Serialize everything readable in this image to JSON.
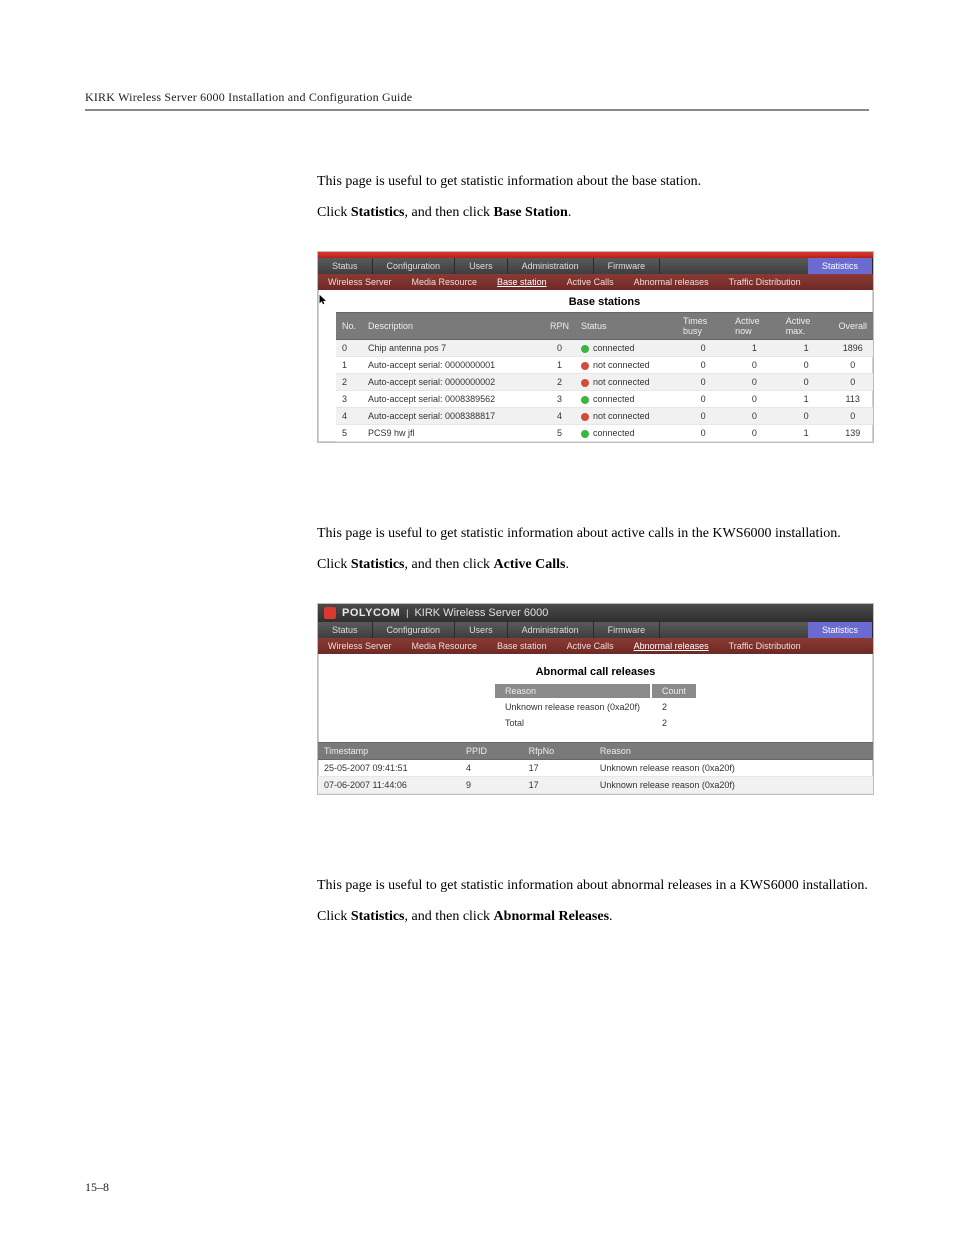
{
  "running_head": "KIRK Wireless Server 6000 Installation and Configuration Guide",
  "page_number": "15–8",
  "sections": {
    "base_intro": "This page is useful to get statistic information about the base station.",
    "base_click_pre": "Click ",
    "base_click_b1": "Statistics",
    "base_click_mid": ", and then click ",
    "base_click_b2": "Base Station",
    "base_click_post": ".",
    "active_intro": "This page is useful to get statistic information about active calls in the KWS6000 installation.",
    "active_click_b2": "Active Calls",
    "abn_intro": "This page is useful to get statistic information about abnormal releases in a KWS6000 installation.",
    "abn_click_b2": "Abnormal Releases"
  },
  "shot_nav": {
    "menus": [
      "Status",
      "Configuration",
      "Users",
      "Administration",
      "Firmware",
      "Statistics"
    ],
    "submenus": [
      "Wireless Server",
      "Media Resource",
      "Base station",
      "Active Calls",
      "Abnormal releases",
      "Traffic Distribution"
    ]
  },
  "shot_base": {
    "title": "Base stations",
    "headers": [
      "No.",
      "Description",
      "RPN",
      "Status",
      "Times busy",
      "Active now",
      "Active max.",
      "Overall"
    ],
    "rows": [
      {
        "no": "0",
        "desc": "Chip antenna pos 7",
        "rpn": "0",
        "status": "connected",
        "dot": "green",
        "busy": "0",
        "now": "1",
        "max": "1",
        "overall": "1896"
      },
      {
        "no": "1",
        "desc": "Auto-accept serial: 0000000001",
        "rpn": "1",
        "status": "not connected",
        "dot": "red",
        "busy": "0",
        "now": "0",
        "max": "0",
        "overall": "0"
      },
      {
        "no": "2",
        "desc": "Auto-accept serial: 0000000002",
        "rpn": "2",
        "status": "not connected",
        "dot": "red",
        "busy": "0",
        "now": "0",
        "max": "0",
        "overall": "0"
      },
      {
        "no": "3",
        "desc": "Auto-accept serial: 0008389562",
        "rpn": "3",
        "status": "connected",
        "dot": "green",
        "busy": "0",
        "now": "0",
        "max": "1",
        "overall": "113"
      },
      {
        "no": "4",
        "desc": "Auto-accept serial: 0008388817",
        "rpn": "4",
        "status": "not connected",
        "dot": "red",
        "busy": "0",
        "now": "0",
        "max": "0",
        "overall": "0"
      },
      {
        "no": "5",
        "desc": "PCS9 hw jfl",
        "rpn": "5",
        "status": "connected",
        "dot": "green",
        "busy": "0",
        "now": "0",
        "max": "1",
        "overall": "139"
      }
    ]
  },
  "shot_titlebar": {
    "brand": "POLYCOM",
    "product": "KIRK Wireless Server 6000"
  },
  "shot_abn": {
    "title": "Abnormal call releases",
    "summary_headers": [
      "Reason",
      "Count"
    ],
    "summary_rows": [
      {
        "reason": "Unknown release reason (0xa20f)",
        "count": "2"
      },
      {
        "reason": "Total",
        "count": "2"
      }
    ],
    "headers": [
      "Timestamp",
      "PPID",
      "RfpNo",
      "Reason"
    ],
    "rows": [
      {
        "ts": "25-05-2007 09:41:51",
        "ppid": "4",
        "rfp": "17",
        "reason": "Unknown release reason (0xa20f)"
      },
      {
        "ts": "07-06-2007 11:44:06",
        "ppid": "9",
        "rfp": "17",
        "reason": "Unknown release reason (0xa20f)"
      }
    ]
  }
}
